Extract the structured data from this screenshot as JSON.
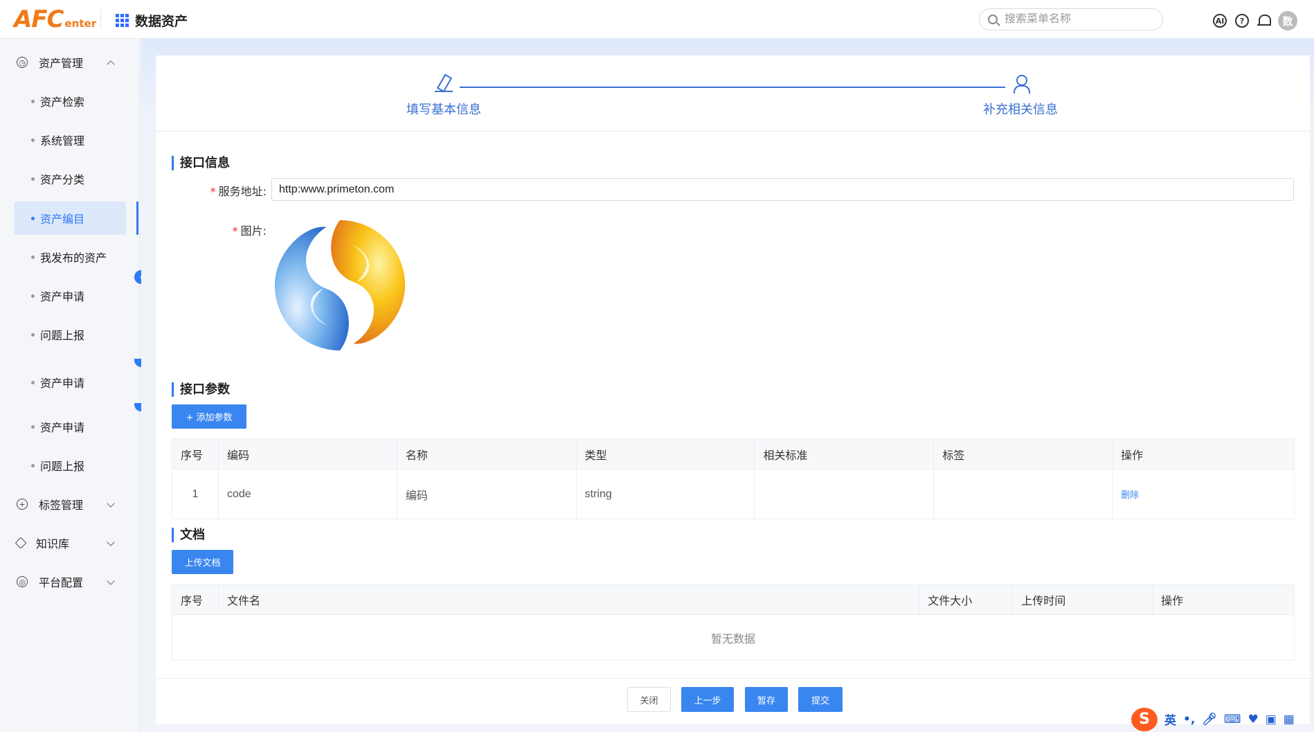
{
  "header": {
    "logo_main": "AFC",
    "logo_sub": "enter",
    "app_title": "数据资产",
    "search_placeholder": "搜索菜单名称",
    "ai_icon_text": "AI",
    "help_icon_text": "?",
    "avatar_text": "数"
  },
  "sidebar": {
    "groups": [
      {
        "label": "资产管理",
        "expanded": true
      },
      {
        "label": "标签管理",
        "expanded": false
      },
      {
        "label": "知识库",
        "expanded": false
      },
      {
        "label": "平台配置",
        "expanded": false
      }
    ],
    "items": [
      {
        "label": "资产检索"
      },
      {
        "label": "系统管理"
      },
      {
        "label": "资产分类"
      },
      {
        "label": "资产编目",
        "active": true
      },
      {
        "label": "我发布的资产"
      },
      {
        "label": "资产申请"
      },
      {
        "label": "问题上报"
      },
      {
        "label": "资产申请"
      },
      {
        "label": "资产申请"
      },
      {
        "label": "问题上报"
      }
    ]
  },
  "steps": [
    {
      "label": "填写基本信息",
      "icon": "pencil-icon"
    },
    {
      "label": "补充相关信息",
      "icon": "person-icon"
    }
  ],
  "interface_info": {
    "title": "接口信息",
    "service_label": "服务地址:",
    "service_value": "http:www.primeton.com",
    "image_label": "图片:"
  },
  "params": {
    "title": "接口参数",
    "add_button": "+ 添加参数",
    "columns": [
      "序号",
      "编码",
      "名称",
      "类型",
      "相关标准",
      "标签",
      "操作"
    ],
    "rows": [
      {
        "index": "1",
        "code": "code",
        "name": "编码",
        "type": "string",
        "standard": "",
        "tag": "",
        "action": "删除"
      }
    ]
  },
  "docs": {
    "title": "文档",
    "upload_button": "上传文档",
    "columns": [
      "序号",
      "文件名",
      "文件大小",
      "上传时间",
      "操作"
    ],
    "empty_text": "暂无数据"
  },
  "footer": {
    "close": "关闭",
    "prev": "上一步",
    "save": "暂存",
    "submit": "提交"
  },
  "ime": {
    "logo": "S",
    "lang": "英",
    "punct": "•,"
  },
  "colors": {
    "accent": "#2f7bf5",
    "brand_orange": "#f07a1a",
    "button_blue": "#3a86f0"
  }
}
